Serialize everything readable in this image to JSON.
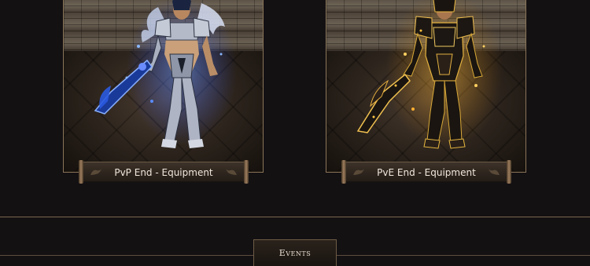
{
  "cards": [
    {
      "id": "pvp",
      "label": "PvP End - Equipment",
      "glow_color": "#3a6cff",
      "armor_color": "#b8bcc8"
    },
    {
      "id": "pve",
      "label": "PvE End - Equipment",
      "glow_color": "#e8a820",
      "armor_color": "#1a1612"
    }
  ],
  "section": {
    "events_label": "Events"
  },
  "icons": {
    "banner_ornament": "dragon-ornament-icon"
  }
}
